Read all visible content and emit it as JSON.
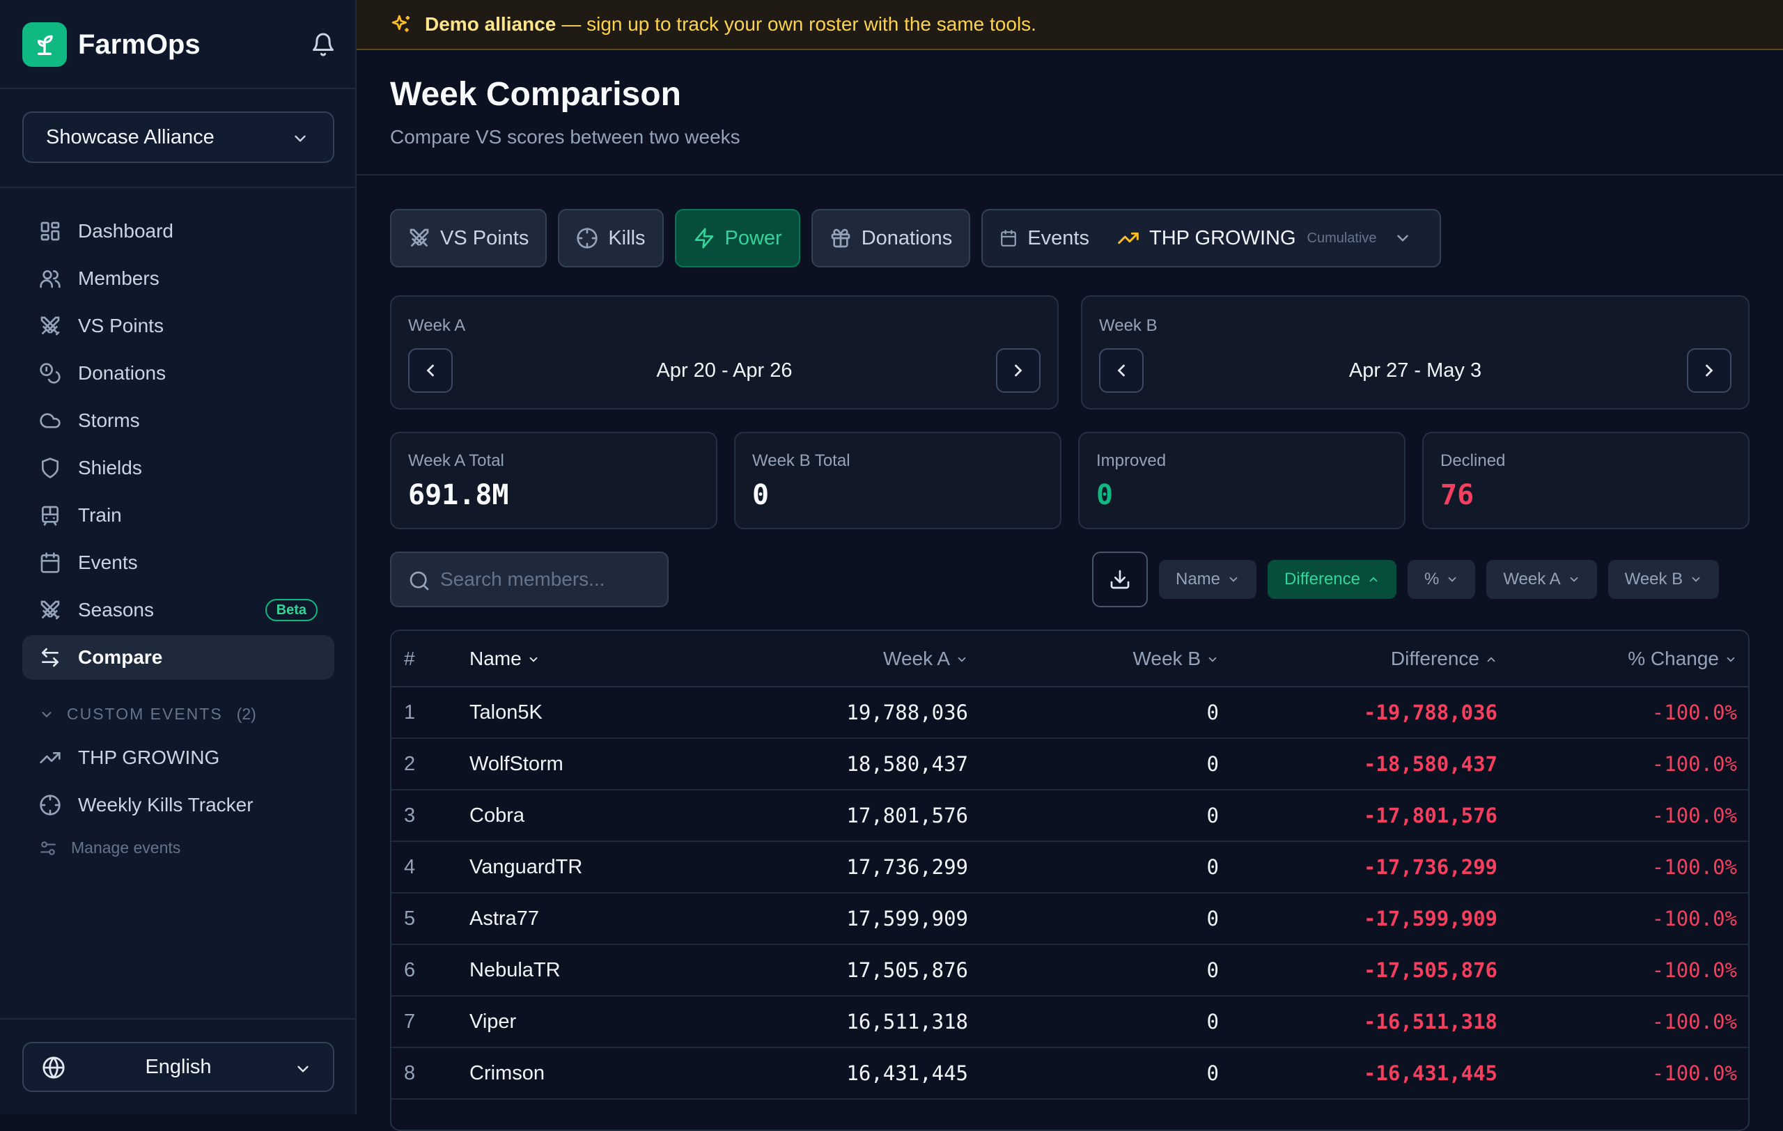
{
  "app": {
    "name": "FarmOps"
  },
  "sidebar": {
    "alliance": "Showcase Alliance",
    "nav": [
      {
        "label": "Dashboard",
        "icon": "dashboard-icon"
      },
      {
        "label": "Members",
        "icon": "users-icon"
      },
      {
        "label": "VS Points",
        "icon": "swords-icon"
      },
      {
        "label": "Donations",
        "icon": "coins-icon"
      },
      {
        "label": "Storms",
        "icon": "cloud-icon"
      },
      {
        "label": "Shields",
        "icon": "shield-icon"
      },
      {
        "label": "Train",
        "icon": "train-icon"
      },
      {
        "label": "Events",
        "icon": "calendar-icon"
      },
      {
        "label": "Seasons",
        "icon": "swords-icon",
        "badge": "Beta"
      },
      {
        "label": "Compare",
        "icon": "compare-icon",
        "active": true
      }
    ],
    "custom_events": {
      "heading": "CUSTOM EVENTS",
      "count": "(2)",
      "items": [
        {
          "label": "THP GROWING",
          "icon": "trending-up-icon"
        },
        {
          "label": "Weekly Kills Tracker",
          "icon": "crosshair-icon"
        }
      ],
      "manage": "Manage events"
    },
    "language": "English"
  },
  "banner": {
    "strong": "Demo alliance",
    "rest": "— sign up to track your own roster with the same tools."
  },
  "header": {
    "title": "Week Comparison",
    "subtitle": "Compare VS scores between two weeks"
  },
  "tabs": {
    "vs_points": "VS Points",
    "kills": "Kills",
    "power": "Power",
    "donations": "Donations",
    "events": "Events",
    "selected_event": "THP GROWING",
    "selected_event_tag": "Cumulative",
    "active": "Power"
  },
  "weeks": {
    "a": {
      "label": "Week A",
      "range": "Apr 20 - Apr 26"
    },
    "b": {
      "label": "Week B",
      "range": "Apr 27 - May 3"
    }
  },
  "stats": {
    "week_a_total": {
      "label": "Week A Total",
      "value": "691.8M"
    },
    "week_b_total": {
      "label": "Week B Total",
      "value": "0"
    },
    "improved": {
      "label": "Improved",
      "value": "0"
    },
    "declined": {
      "label": "Declined",
      "value": "76"
    }
  },
  "search": {
    "placeholder": "Search members..."
  },
  "sort": {
    "options": [
      "Name",
      "Difference",
      "%",
      "Week A",
      "Week B"
    ],
    "active": "Difference"
  },
  "table": {
    "headers": {
      "rank": "#",
      "name": "Name",
      "week_a": "Week A",
      "week_b": "Week B",
      "difference": "Difference",
      "pct": "% Change"
    },
    "rows": [
      {
        "rank": "1",
        "name": "Talon5K",
        "week_a": "19,788,036",
        "week_b": "0",
        "difference": "-19,788,036",
        "pct": "-100.0%"
      },
      {
        "rank": "2",
        "name": "WolfStorm",
        "week_a": "18,580,437",
        "week_b": "0",
        "difference": "-18,580,437",
        "pct": "-100.0%"
      },
      {
        "rank": "3",
        "name": "Cobra",
        "week_a": "17,801,576",
        "week_b": "0",
        "difference": "-17,801,576",
        "pct": "-100.0%"
      },
      {
        "rank": "4",
        "name": "VanguardTR",
        "week_a": "17,736,299",
        "week_b": "0",
        "difference": "-17,736,299",
        "pct": "-100.0%"
      },
      {
        "rank": "5",
        "name": "Astra77",
        "week_a": "17,599,909",
        "week_b": "0",
        "difference": "-17,599,909",
        "pct": "-100.0%"
      },
      {
        "rank": "6",
        "name": "NebulaTR",
        "week_a": "17,505,876",
        "week_b": "0",
        "difference": "-17,505,876",
        "pct": "-100.0%"
      },
      {
        "rank": "7",
        "name": "Viper",
        "week_a": "16,511,318",
        "week_b": "0",
        "difference": "-16,511,318",
        "pct": "-100.0%"
      },
      {
        "rank": "8",
        "name": "Crimson",
        "week_a": "16,431,445",
        "week_b": "0",
        "difference": "-16,431,445",
        "pct": "-100.0%"
      }
    ]
  },
  "colors": {
    "accent": "#10b981",
    "negative": "#f43f5e",
    "banner_text": "#fcd34d",
    "background": "#0b1120",
    "sidebar": "#0f172a"
  }
}
